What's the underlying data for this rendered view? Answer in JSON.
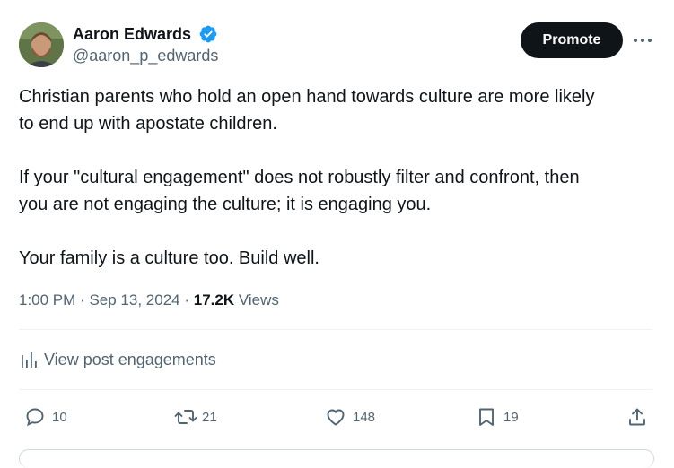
{
  "author": {
    "name": "Aaron Edwards",
    "handle": "@aaron_p_edwards",
    "verified": true,
    "avatar_icon": "user-avatar-photo"
  },
  "header": {
    "promote_label": "Promote",
    "more_icon": "more-horizontal-icon"
  },
  "tweet": {
    "line1": "Christian parents who hold an open hand towards culture are more likely",
    "line2": "to end up with apostate children.",
    "line3": "If your \"cultural engagement\" does not robustly filter and confront, then",
    "line4": "you are not engaging the culture; it is engaging you.",
    "line5": "Your family is a culture too. Build well."
  },
  "meta": {
    "time": "1:00 PM",
    "date": "Sep 13, 2024",
    "separator": "·",
    "views_count": "17.2K",
    "views_label": "Views"
  },
  "engagements": {
    "label": "View post engagements",
    "icon": "bar-chart-icon"
  },
  "actions": {
    "replies": "10",
    "reposts": "21",
    "likes": "148",
    "bookmarks": "19"
  },
  "colors": {
    "text": "#0f1419",
    "secondary": "#536471",
    "verified": "#1d9bf0",
    "divider": "#eff3f4",
    "button_bg": "#0f1419"
  }
}
